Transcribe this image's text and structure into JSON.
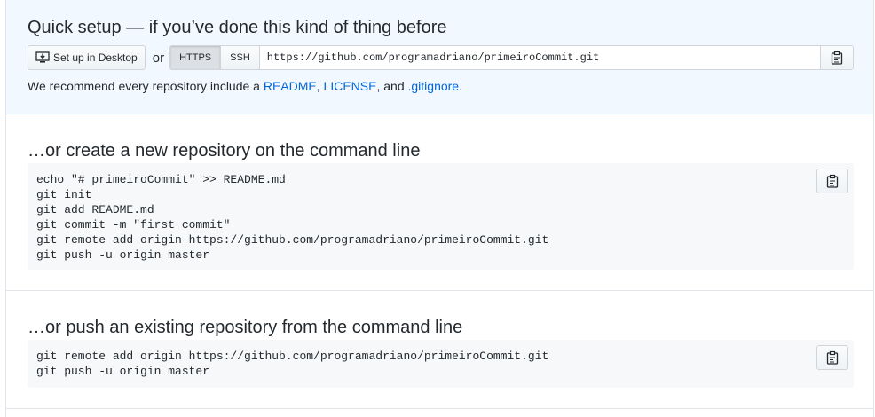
{
  "quick_setup": {
    "title": "Quick setup — if you’ve done this kind of thing before",
    "desktop_button": "Set up in Desktop",
    "or_text": "or",
    "protocols": [
      "HTTPS",
      "SSH"
    ],
    "selected_protocol": "HTTPS",
    "clone_url": "https://github.com/programadriano/primeiroCommit.git",
    "recommend": {
      "prefix": "We recommend every repository include a ",
      "readme": "README",
      "sep1": ", ",
      "license": "LICENSE",
      "sep2": ", and ",
      "gitignore": ".gitignore",
      "suffix": "."
    }
  },
  "create_section": {
    "title": "…or create a new repository on the command line",
    "commands": [
      "echo \"# primeiroCommit\" >> README.md",
      "git init",
      "git add README.md",
      "git commit -m \"first commit\"",
      "git remote add origin https://github.com/programadriano/primeiroCommit.git",
      "git push -u origin master"
    ]
  },
  "push_section": {
    "title": "…or push an existing repository from the command line",
    "commands": [
      "git remote add origin https://github.com/programadriano/primeiroCommit.git",
      "git push -u origin master"
    ]
  },
  "icons": {
    "desktop": "desktop-download-icon",
    "copy": "clipboard-copy-icon"
  }
}
